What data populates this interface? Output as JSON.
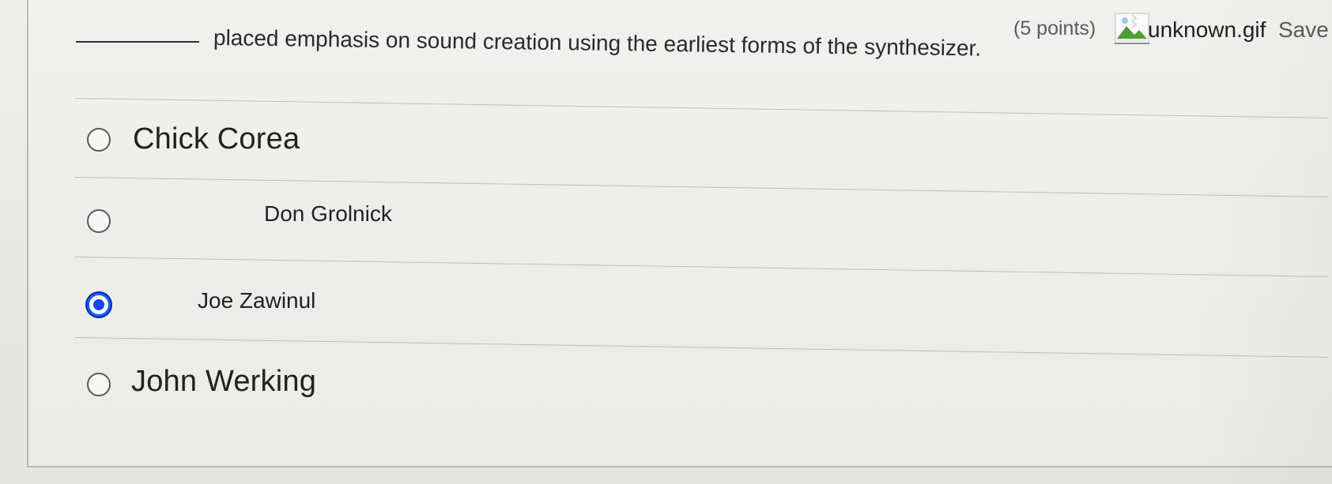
{
  "question": {
    "points_label": "(5 points)",
    "image_name": "unknown.gif",
    "save_label": "Save",
    "prompt": "placed emphasis on sound creation using the earliest forms of the synthesizer.",
    "icon": "broken-image-icon"
  },
  "options": [
    {
      "label": "Chick Corea",
      "selected": false
    },
    {
      "label": "Don Grolnick",
      "selected": false
    },
    {
      "label": "Joe Zawinul",
      "selected": true
    },
    {
      "label": "John Werking",
      "selected": false
    }
  ],
  "colors": {
    "radio_selected": "#1647f2",
    "radio_border": "#5a5a5a",
    "background": "#e9e9e7"
  }
}
